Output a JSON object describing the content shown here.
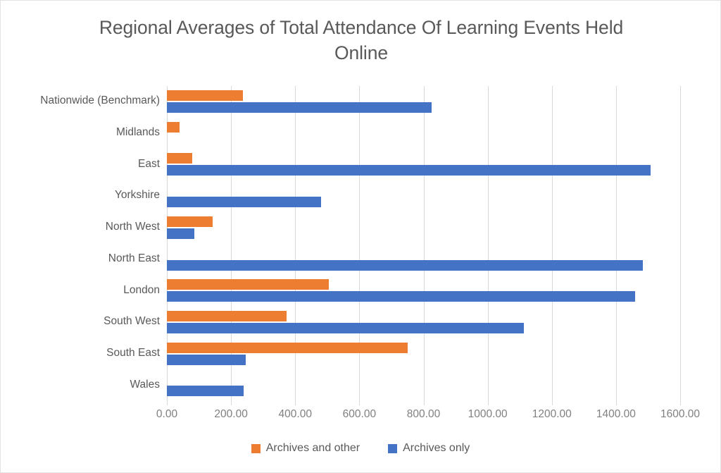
{
  "chart_data": {
    "type": "bar",
    "orientation": "horizontal",
    "title": "Regional Averages of Total Attendance Of Learning Events Held\nOnline",
    "xlabel": "",
    "ylabel": "",
    "xlim": [
      0,
      1600
    ],
    "xticks": [
      "0.00",
      "200.00",
      "400.00",
      "600.00",
      "800.00",
      "1000.00",
      "1200.00",
      "1400.00",
      "1600.00"
    ],
    "xtick_values": [
      0,
      200,
      400,
      600,
      800,
      1000,
      1200,
      1400,
      1600
    ],
    "grid": "vertical",
    "legend_position": "bottom",
    "categories": [
      "Nationwide (Benchmark)",
      "Midlands",
      "East",
      "Yorkshire",
      "North West",
      "North East",
      "London",
      "South West",
      "South East",
      "Wales"
    ],
    "series": [
      {
        "name": "Archives and other",
        "color": "#ED7D31",
        "values": [
          237,
          40,
          79,
          0,
          143,
          0,
          505,
          373,
          751,
          0
        ]
      },
      {
        "name": "Archives only",
        "color": "#4472C4",
        "values": [
          825,
          0,
          1508,
          481,
          86,
          1484,
          1460,
          1112,
          246,
          239
        ]
      }
    ]
  },
  "colors": {
    "series_archives_and_other": "#ED7D31",
    "series_archives_only": "#4472C4",
    "title_text": "#595959",
    "axis_text": "#808080",
    "gridline": "#D9D9D9",
    "frame_border": "#E3E3E3",
    "background": "#FFFFFF"
  }
}
